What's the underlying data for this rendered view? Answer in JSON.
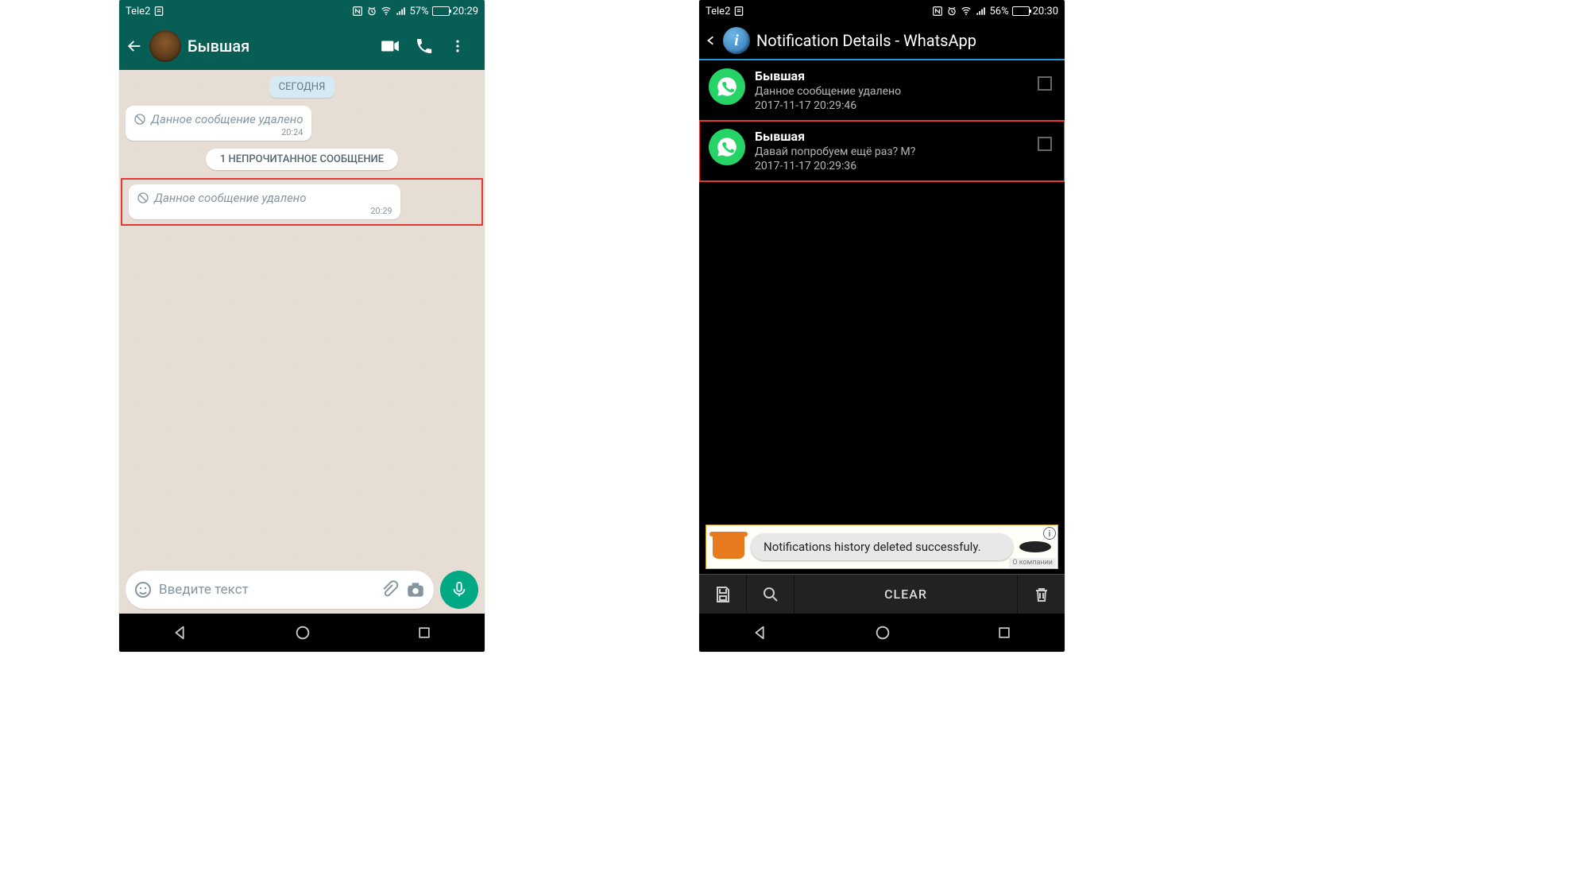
{
  "left": {
    "status": {
      "carrier": "Tele2",
      "battery_pct": "57%",
      "battery_fill": 57,
      "time": "20:29"
    },
    "header": {
      "contact_name": "Бывшая"
    },
    "chat": {
      "date_label": "СЕГОДНЯ",
      "messages": [
        {
          "deleted_text": "Данное сообщение удалено",
          "time": "20:24",
          "highlighted": false
        },
        null,
        {
          "deleted_text": "Данное сообщение удалено",
          "time": "20:29",
          "highlighted": true
        }
      ],
      "unread_banner": "1 НЕПРОЧИТАННОЕ СООБЩЕНИЕ",
      "input_placeholder": "Введите текст"
    }
  },
  "right": {
    "status": {
      "carrier": "Tele2",
      "battery_pct": "56%",
      "battery_fill": 56,
      "time": "20:30"
    },
    "header": {
      "title": "Notification Details - WhatsApp"
    },
    "notifications": [
      {
        "sender": "Бывшая",
        "message": "Данное сообщение удалено",
        "timestamp": "2017-11-17 20:29:46",
        "highlighted": false
      },
      {
        "sender": "Бывшая",
        "message": "Давай попробуем ещё раз? М?",
        "timestamp": "2017-11-17 20:29:36",
        "highlighted": true
      }
    ],
    "ad": {
      "toast_text": "Notifications history deleted successfuly.",
      "info_label": "О компании"
    },
    "toolbar": {
      "clear_label": "CLEAR"
    }
  }
}
